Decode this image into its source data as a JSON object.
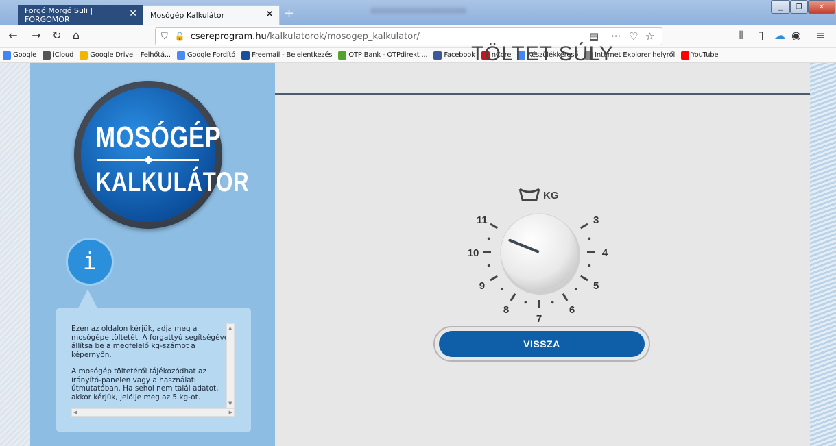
{
  "browser": {
    "tabs": [
      {
        "label": "Forgó Morgó Suli | FORGOMOR"
      },
      {
        "label": "Mosógép Kalkulátor"
      }
    ],
    "url_host": "csereprogram.hu",
    "url_path": "/kalkulatorok/mosogep_kalkulator/",
    "bookmarks": [
      {
        "label": "Google",
        "icon": "google-icon",
        "color": "#4285f4"
      },
      {
        "label": "iCloud",
        "icon": "apple-icon",
        "color": "#555555"
      },
      {
        "label": "Google Drive – Felhőtá...",
        "icon": "drive-icon",
        "color": "#f4b400"
      },
      {
        "label": "Google Fordító",
        "icon": "translate-icon",
        "color": "#4a8af4"
      },
      {
        "label": "Freemail - Bejelentkezés",
        "icon": "freemail-icon",
        "color": "#1b4f9c"
      },
      {
        "label": "OTP Bank - OTPdirekt ...",
        "icon": "otp-icon",
        "color": "#52a32b"
      },
      {
        "label": "Facebook",
        "icon": "facebook-icon",
        "color": "#3b5998"
      },
      {
        "label": "nCore",
        "icon": "ncore-icon",
        "color": "#c4161c"
      },
      {
        "label": "Készülékkereső",
        "icon": "google-icon",
        "color": "#4285f4"
      },
      {
        "label": "Internet Explorer helyről",
        "icon": "folder-icon",
        "color": "#888888"
      },
      {
        "label": "YouTube",
        "icon": "youtube-icon",
        "color": "#ff0000"
      }
    ]
  },
  "logo": {
    "line1": "MOSÓGÉP",
    "line2": "KALKULÁTOR"
  },
  "info": {
    "icon_label": "i",
    "paragraph1": "Ezen az oldalon kérjük, adja meg a mosógépe töltetét. A forgattyú segítségével állítsa be a megfelelő kg-számot a képernyőn.",
    "paragraph2": "A mosógép töltetéről tájékozódhat az irányító-panelen vagy a használati útmutatóban. Ha sehol nem talál adatot, akkor kérjük, jelölje meg az 5 kg-ot."
  },
  "main": {
    "title": "TÖLTET SÚLY",
    "unit_label": "KG",
    "dial_numbers": [
      "3",
      "4",
      "5",
      "6",
      "7",
      "8",
      "9",
      "10",
      "11"
    ],
    "selected_value": "10",
    "back_label": "VISSZA"
  }
}
